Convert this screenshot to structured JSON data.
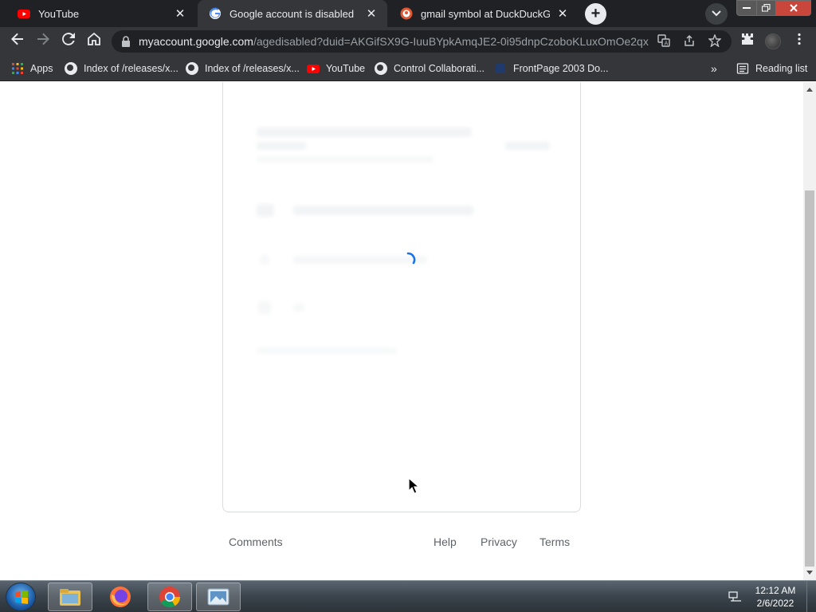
{
  "tabs": [
    {
      "title": "YouTube",
      "favicon": "youtube-icon",
      "active": false
    },
    {
      "title": "Google account is disabled",
      "favicon": "google-icon",
      "active": true
    },
    {
      "title": "gmail symbol at DuckDuckGo",
      "favicon": "duckduckgo-icon",
      "active": false
    }
  ],
  "toolbar": {
    "url_host": "myaccount.google.com",
    "url_path": "/agedisabled?duid=AKGifSX9G-IuuBYpkAmqJE2-0i95dnpCzoboKLuxOmOe2qx..."
  },
  "bookmarks": {
    "items": [
      {
        "label": "Apps",
        "icon": "apps-grid-icon"
      },
      {
        "label": "Index of /releases/x...",
        "icon": "globe-icon"
      },
      {
        "label": "Index of /releases/x...",
        "icon": "globe-icon"
      },
      {
        "label": "YouTube",
        "icon": "youtube-icon"
      },
      {
        "label": "Control Collaborati...",
        "icon": "globe-icon"
      },
      {
        "label": "FrontPage 2003 Do...",
        "icon": "frontpage-icon"
      }
    ],
    "reading_list": "Reading list"
  },
  "footer": {
    "comments": "Comments",
    "help": "Help",
    "privacy": "Privacy",
    "terms": "Terms"
  },
  "taskbar": {
    "time": "12:12 AM",
    "date": "2/6/2022"
  },
  "colors": {
    "chrome_dark": "#202124",
    "chrome_toolbar": "#35363a",
    "youtube_red": "#ff0000",
    "spinner_blue": "#1a73e8",
    "close_red": "#c9463d"
  }
}
